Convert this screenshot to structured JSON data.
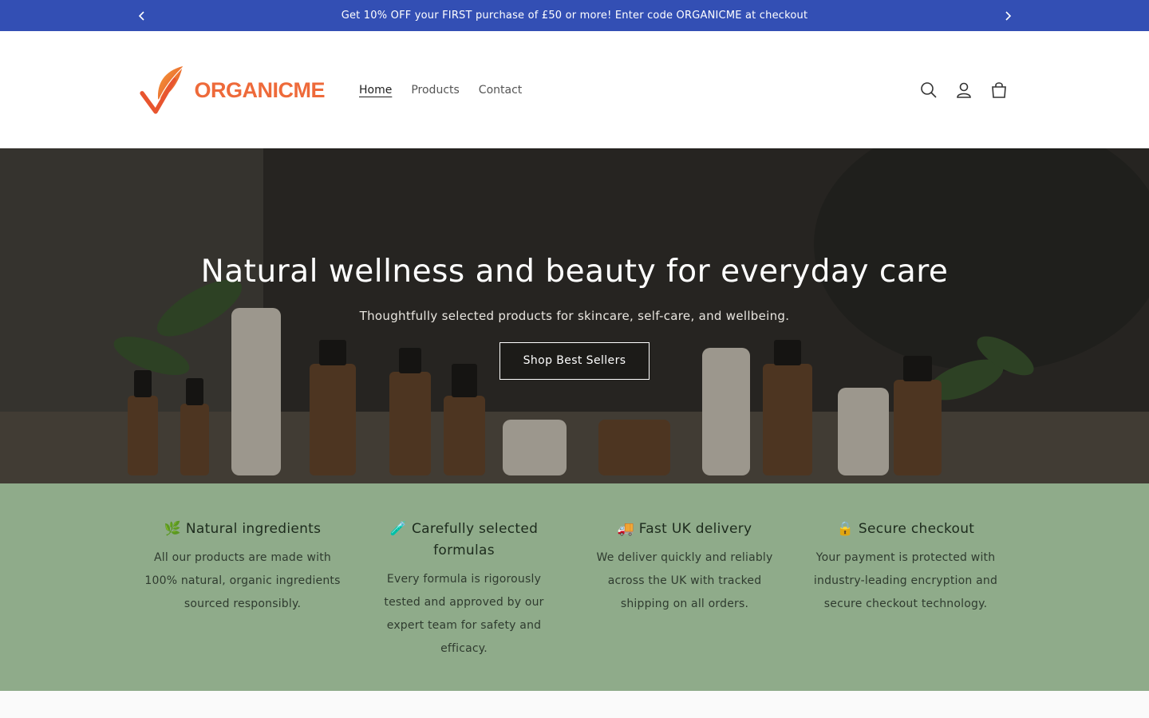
{
  "announcement": {
    "text": "Get 10% OFF your FIRST purchase of £50 or more! Enter code ORGANICME at checkout",
    "prev_icon": "chevron-left-icon",
    "next_icon": "chevron-right-icon"
  },
  "brand": {
    "name": "ORGANICME",
    "accent": "#ee6a3a",
    "announce_bg": "#334fb4",
    "features_bg": "#8fab8a"
  },
  "nav": {
    "items": [
      {
        "label": "Home",
        "active": true
      },
      {
        "label": "Products",
        "active": false
      },
      {
        "label": "Contact",
        "active": false
      }
    ]
  },
  "header_icons": [
    "search-icon",
    "account-icon",
    "cart-icon"
  ],
  "hero": {
    "title": "Natural wellness and beauty for everyday care",
    "subtitle": "Thoughtfully selected products for skincare, self-care, and wellbeing.",
    "button": "Shop Best Sellers"
  },
  "features": [
    {
      "emoji": "🌿",
      "title": "Natural ingredients",
      "text": "All our products are made with 100% natural, organic ingredients sourced responsibly."
    },
    {
      "emoji": "🧪",
      "title": "Carefully selected formulas",
      "text": "Every formula is rigorously tested and approved by our expert team for safety and efficacy."
    },
    {
      "emoji": "🚚",
      "title": "Fast UK delivery",
      "text": "We deliver quickly and reliably across the UK with tracked shipping on all orders."
    },
    {
      "emoji": "🔒",
      "title": "Secure checkout",
      "text": "Your payment is protected with industry-leading encryption and secure checkout technology."
    }
  ]
}
